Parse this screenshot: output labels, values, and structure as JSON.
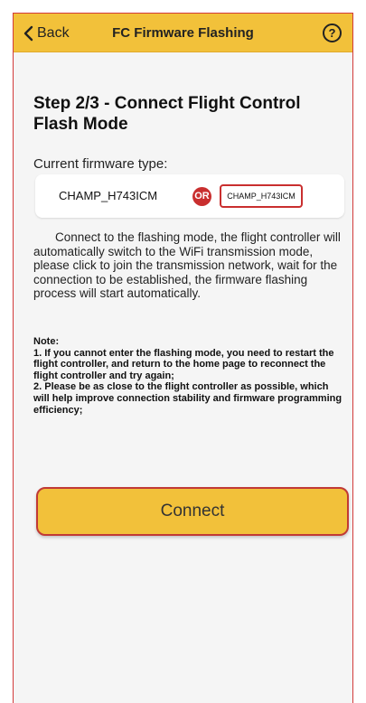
{
  "navbar": {
    "back_label": "Back",
    "title": "FC Firmware Flashing",
    "help_symbol": "?"
  },
  "step": {
    "title": "Step 2/3 - Connect Flight Control Flash Mode"
  },
  "firmware": {
    "label": "Current firmware type:",
    "primary": "CHAMP_H743ICM",
    "or_label": "OR",
    "alternate": "CHAMP_H743ICM"
  },
  "description": "Connect to the flashing mode, the flight controller will automatically switch to the WiFi transmission mode, please click to join the transmission network, wait for the connection to be established, the firmware flashing process will start automatically.",
  "note": {
    "heading": "Note:",
    "items": [
      "1. If you cannot enter the flashing mode, you need to restart the flight controller, and return to the home page to reconnect the flight controller and try again;",
      "2. Please be as close to the flight controller as possible, which will help improve connection stability and firmware programming efficiency;"
    ]
  },
  "actions": {
    "connect_label": "Connect"
  },
  "colors": {
    "accent": "#f2c13a",
    "highlight_red": "#c92f2f"
  }
}
